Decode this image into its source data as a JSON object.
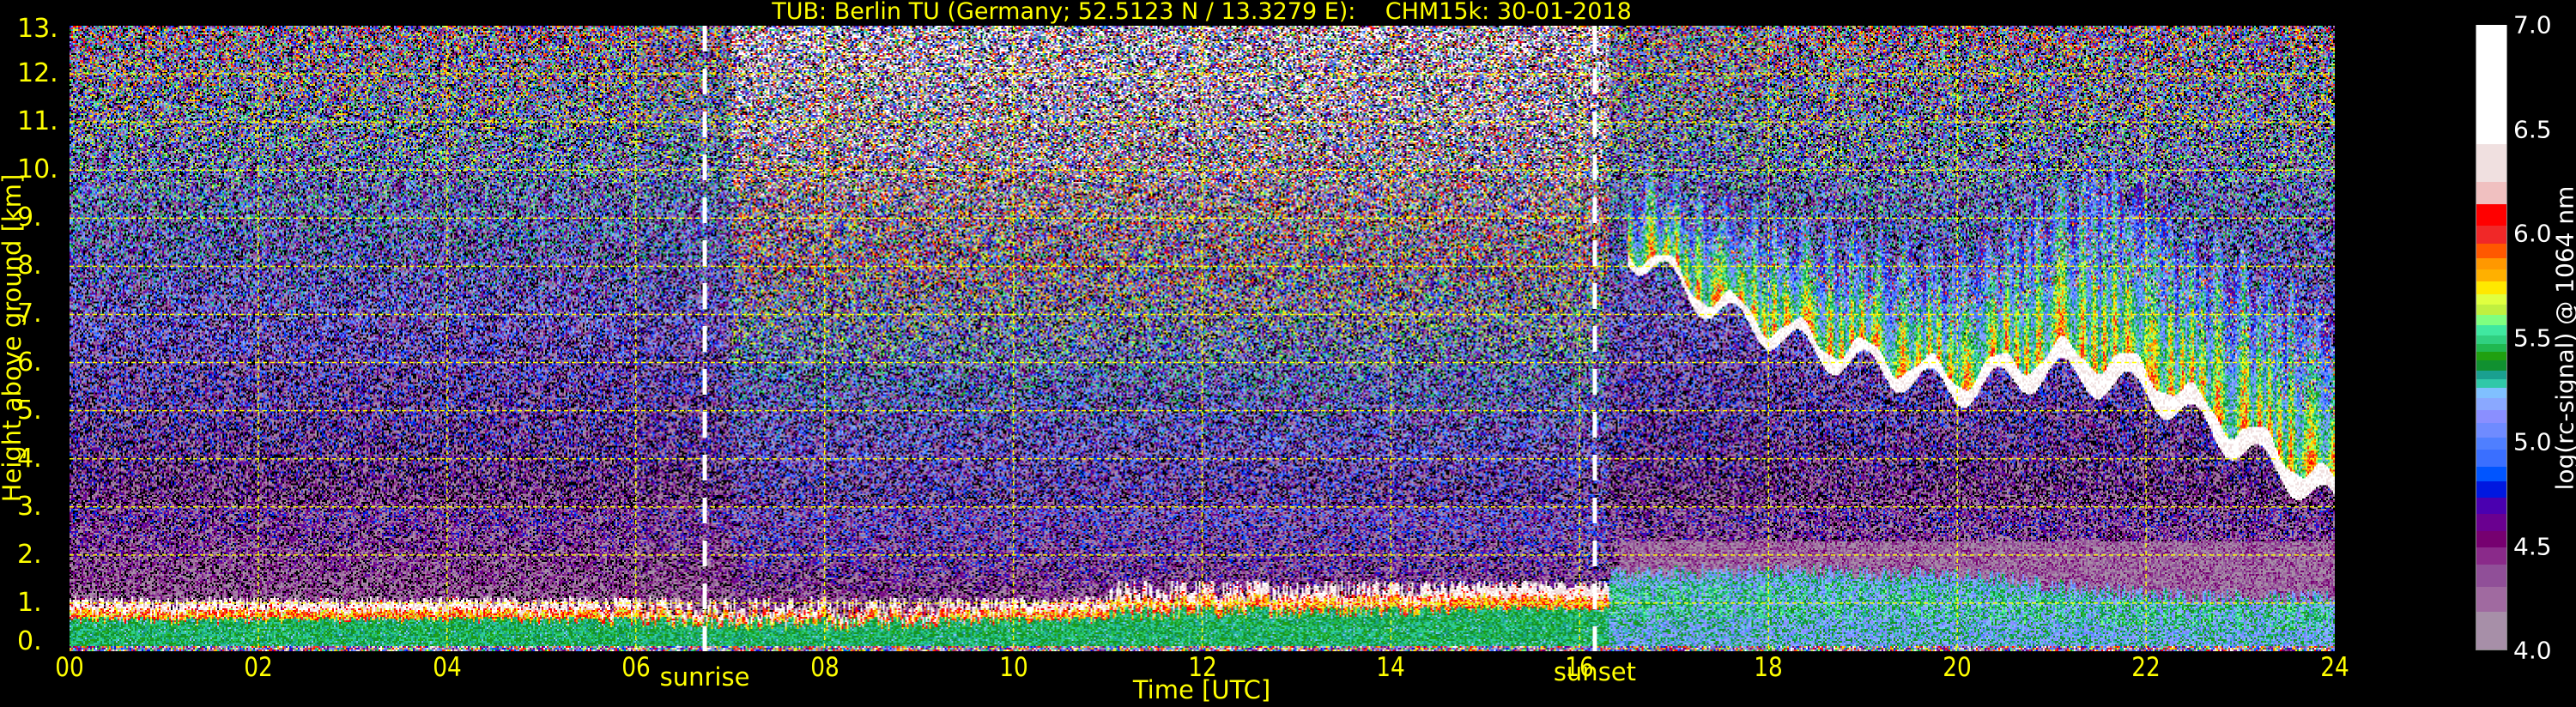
{
  "title": "TUB: Berlin TU (Germany; 52.5123 N / 13.3279 E):    CHM15k: 30-01-2018",
  "chart_data": {
    "type": "heatmap",
    "title": "TUB: Berlin TU (Germany; 52.5123 N / 13.3279 E):    CHM15k: 30-01-2018",
    "xlabel": "Time [UTC]",
    "ylabel": "Height above ground [km]",
    "xlim": [
      0,
      24
    ],
    "ylim": [
      0,
      13
    ],
    "x_ticks": [
      "00",
      "02",
      "04",
      "06",
      "08",
      "10",
      "12",
      "14",
      "16",
      "18",
      "20",
      "22",
      "24"
    ],
    "x_tick_values": [
      0,
      2,
      4,
      6,
      8,
      10,
      12,
      14,
      16,
      18,
      20,
      22,
      24
    ],
    "y_ticks": [
      "0.",
      "1.",
      "2.",
      "3.",
      "4.",
      "5.",
      "6.",
      "7.",
      "8.",
      "9.",
      "10.",
      "11.",
      "12.",
      "13."
    ],
    "y_tick_values": [
      0,
      1,
      2,
      3,
      4,
      5,
      6,
      7,
      8,
      9,
      10,
      11,
      12,
      13
    ],
    "grid": true,
    "grid_color": "#ffff00",
    "events": [
      {
        "label": "sunrise",
        "time": 6.73
      },
      {
        "label": "sunset",
        "time": 16.16
      }
    ],
    "features": {
      "boundary_layer_top_km": {
        "time": [
          0,
          4,
          8,
          12,
          14,
          16.3,
          18,
          20,
          22,
          24
        ],
        "height": [
          1.1,
          1.2,
          0.9,
          1.3,
          1.4,
          1.6,
          1.7,
          1.6,
          1.2,
          1.1
        ]
      },
      "cloud_base_km": {
        "time": [
          16.5,
          17.5,
          18.5,
          20,
          21,
          22,
          23,
          24
        ],
        "height": [
          8.3,
          7.0,
          6.2,
          5.4,
          5.8,
          5.4,
          4.2,
          3.0
        ]
      },
      "cloud_top_km": {
        "time": [
          16.5,
          18,
          20,
          21.5,
          22.5,
          24
        ],
        "height": [
          9.8,
          8.8,
          8.0,
          10.0,
          8.5,
          6.8
        ]
      }
    },
    "colorbar": {
      "label": "log(rc-signal) @ 1064 nm",
      "range": [
        4.0,
        7.0
      ],
      "ticks": [
        "4.0",
        "4.5",
        "5.0",
        "5.5",
        "6.0",
        "6.5",
        "7.0"
      ],
      "tick_values": [
        4.0,
        4.5,
        5.0,
        5.5,
        6.0,
        6.5,
        7.0
      ],
      "levels": [
        [
          4.0,
          "#a78fa8"
        ],
        [
          4.18,
          "#a06aa0"
        ],
        [
          4.3,
          "#904f98"
        ],
        [
          4.41,
          "#8a2a8a"
        ],
        [
          4.49,
          "#760070"
        ],
        [
          4.57,
          "#6a0090"
        ],
        [
          4.65,
          "#4a00b0"
        ],
        [
          4.73,
          "#0018e0"
        ],
        [
          4.81,
          "#0055ff"
        ],
        [
          4.88,
          "#3a6fff"
        ],
        [
          4.96,
          "#4f7fff"
        ],
        [
          5.02,
          "#6f8bff"
        ],
        [
          5.09,
          "#8a8fff"
        ],
        [
          5.15,
          "#8aa8ff"
        ],
        [
          5.21,
          "#80c0ff"
        ],
        [
          5.26,
          "#30c8a8"
        ],
        [
          5.3,
          "#1aa090"
        ],
        [
          5.34,
          "#109030"
        ],
        [
          5.39,
          "#20a010"
        ],
        [
          5.43,
          "#20b850"
        ],
        [
          5.47,
          "#30d080"
        ],
        [
          5.51,
          "#40e8a0"
        ],
        [
          5.56,
          "#80ff80"
        ],
        [
          5.61,
          "#c0f040"
        ],
        [
          5.66,
          "#e0ff40"
        ],
        [
          5.71,
          "#ffe800"
        ],
        [
          5.77,
          "#ffb000"
        ],
        [
          5.83,
          "#ff9800"
        ],
        [
          5.88,
          "#ff5800"
        ],
        [
          5.95,
          "#f02828"
        ],
        [
          6.04,
          "#ff0000"
        ],
        [
          6.14,
          "#f0c0c0"
        ],
        [
          6.25,
          "#f0e0e0"
        ],
        [
          6.43,
          "#ffffff"
        ]
      ]
    }
  }
}
